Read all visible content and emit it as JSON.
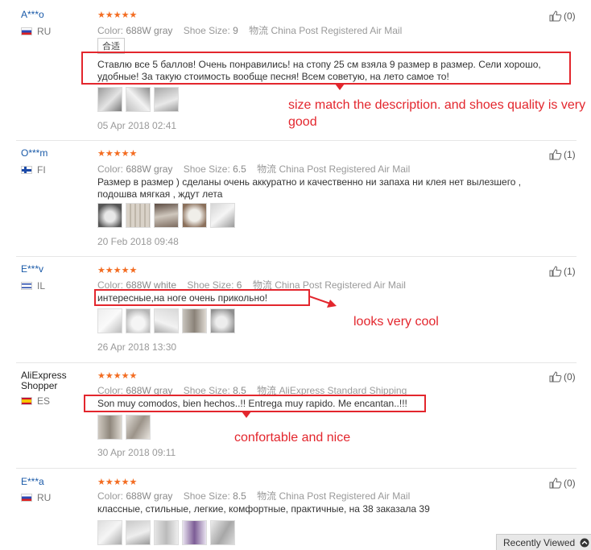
{
  "reviews": [
    {
      "user": "A***o",
      "country": "RU",
      "stars": "★★★★★",
      "color_label": "Color:",
      "color_value": "688W gray",
      "size_label": "Shoe Size:",
      "size_value": "9",
      "ship_label": "物流",
      "ship_value": "China Post Registered Air Mail",
      "tag": "合适",
      "text": "Ставлю все 5 баллов! Очень понравились! на стопу 25 см взяла 9 размер в размер. Сели хорошо, удобные! За такую стоимость вообще песня! Всем советую, на лето самое то!",
      "date": "05 Apr 2018 02:41",
      "likes": "(0)",
      "annotation": "size match the description. and shoes quality is very good"
    },
    {
      "user": "O***m",
      "country": "FI",
      "stars": "★★★★★",
      "color_label": "Color:",
      "color_value": "688W gray",
      "size_label": "Shoe Size:",
      "size_value": "6.5",
      "ship_label": "物流",
      "ship_value": "China Post Registered Air Mail",
      "text": "Размер в размер ) сделаны очень аккуратно и качественно ни запаха ни клея нет вылезшего , подошва мягкая , ждут лета",
      "date": "20 Feb 2018 09:48",
      "likes": "(1)"
    },
    {
      "user": "E***v",
      "country": "IL",
      "stars": "★★★★★",
      "color_label": "Color:",
      "color_value": "688W white",
      "size_label": "Shoe Size:",
      "size_value": "6",
      "ship_label": "物流",
      "ship_value": "China Post Registered Air Mail",
      "text": "интересные,на ноге очень прикольно!",
      "date": "26 Apr 2018 13:30",
      "likes": "(1)",
      "annotation": "looks very cool"
    },
    {
      "user": "AliExpress Shopper",
      "country": "ES",
      "stars": "★★★★★",
      "color_label": "Color:",
      "color_value": "688W gray",
      "size_label": "Shoe Size:",
      "size_value": "8.5",
      "ship_label": "物流",
      "ship_value": "AliExpress Standard Shipping",
      "text": "Son muy comodos, bien hechos..!! Entrega muy rapido. Me encantan..!!!",
      "date": "30 Apr 2018 09:11",
      "likes": "(0)",
      "annotation": "confortable and nice"
    },
    {
      "user": "E***a",
      "country": "RU",
      "stars": "★★★★★",
      "color_label": "Color:",
      "color_value": "688W gray",
      "size_label": "Shoe Size:",
      "size_value": "8.5",
      "ship_label": "物流",
      "ship_value": "China Post Registered Air Mail",
      "text": "классные, стильные, легкие, комфортные, практичные, на 38 заказала 39",
      "likes": "(0)"
    }
  ],
  "recently_viewed": "Recently Viewed",
  "colors": {
    "accent": "#e3262d",
    "star": "#f36c21",
    "link": "#1a5aa8"
  },
  "icons": {
    "like": "thumbs-up-icon",
    "recent": "chevron-up-icon"
  }
}
